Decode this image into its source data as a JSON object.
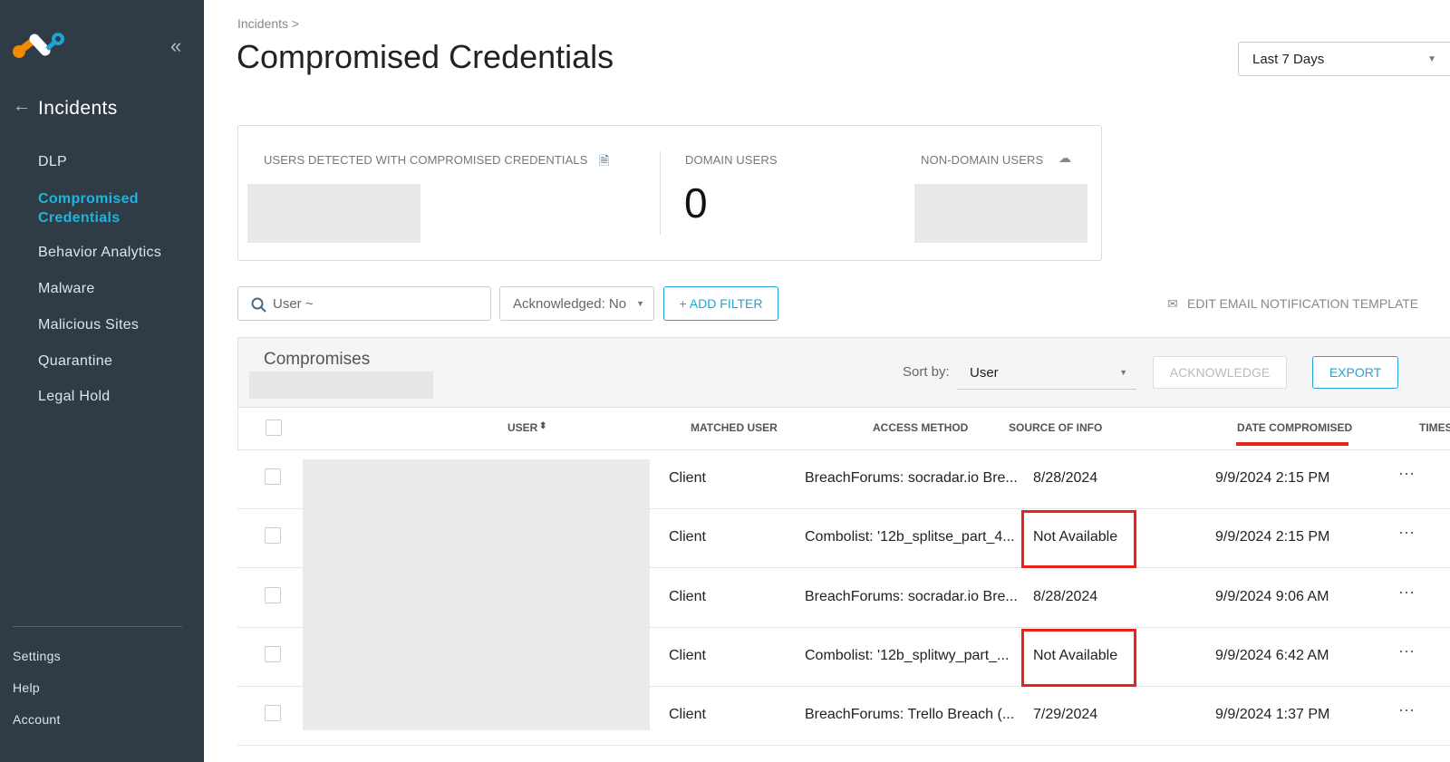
{
  "sidebar": {
    "back_label": "Incidents",
    "items": [
      {
        "label": "DLP"
      },
      {
        "label": "Compromised Credentials"
      },
      {
        "label": "Behavior Analytics"
      },
      {
        "label": "Malware"
      },
      {
        "label": "Malicious Sites"
      },
      {
        "label": "Quarantine"
      },
      {
        "label": "Legal Hold"
      }
    ],
    "active": "Compromised Credentials",
    "bottom": [
      {
        "label": "Settings"
      },
      {
        "label": "Help"
      },
      {
        "label": "Account"
      }
    ]
  },
  "header": {
    "breadcrumb": "Incidents >",
    "title": "Compromised Credentials",
    "range": "Last 7 Days"
  },
  "summary": {
    "users_detected_label": "USERS DETECTED WITH COMPROMISED CREDENTIALS",
    "domain_users_label": "DOMAIN USERS",
    "domain_users_value": "0",
    "non_domain_label": "NON-DOMAIN USERS"
  },
  "filters": {
    "search_placeholder": "User ~",
    "acknowledged": "Acknowledged: No",
    "add_filter": "+ ADD FILTER",
    "edit_email": "EDIT EMAIL NOTIFICATION TEMPLATE"
  },
  "panel": {
    "title": "Compromises",
    "sort_label": "Sort by:",
    "sort_value": "User",
    "acknowledge": "ACKNOWLEDGE",
    "export": "EXPORT"
  },
  "table": {
    "columns": [
      "USER",
      "MATCHED USER",
      "ACCESS METHOD",
      "SOURCE OF INFO",
      "DATE COMPROMISED",
      "TIMESTAMP"
    ],
    "rows": [
      {
        "access": "Client",
        "source": "BreachForums: socradar.io Bre...",
        "date": "8/28/2024",
        "timestamp": "9/9/2024 2:15 PM"
      },
      {
        "access": "Client",
        "source": "Combolist: '12b_splitse_part_4...",
        "date": "Not Available",
        "timestamp": "9/9/2024 2:15 PM"
      },
      {
        "access": "Client",
        "source": "BreachForums: socradar.io Bre...",
        "date": "8/28/2024",
        "timestamp": "9/9/2024 9:06 AM"
      },
      {
        "access": "Client",
        "source": "Combolist: '12b_splitwy_part_...",
        "date": "Not Available",
        "timestamp": "9/9/2024 6:42 AM"
      },
      {
        "access": "Client",
        "source": "BreachForums: Trello Breach (...",
        "date": "7/29/2024",
        "timestamp": "9/9/2024 1:37 PM"
      }
    ]
  },
  "colors": {
    "accent": "#1fb3e0",
    "sidebar": "#2f3c46",
    "highlight": "#e8231b"
  }
}
